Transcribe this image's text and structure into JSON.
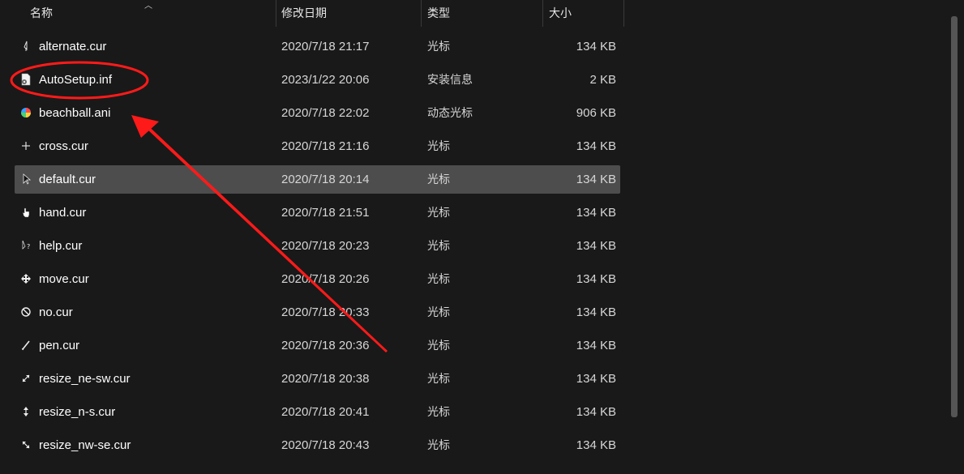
{
  "header": {
    "name": "名称",
    "date": "修改日期",
    "type": "类型",
    "size": "大小"
  },
  "files": [
    {
      "name": "alternate.cur",
      "date": "2020/7/18 21:17",
      "type": "光标",
      "size": "134 KB",
      "icon": "cursor-alternate-icon"
    },
    {
      "name": "AutoSetup.inf",
      "date": "2023/1/22 20:06",
      "type": "安装信息",
      "size": "2 KB",
      "icon": "setup-info-file-icon"
    },
    {
      "name": "beachball.ani",
      "date": "2020/7/18 22:02",
      "type": "动态光标",
      "size": "906 KB",
      "icon": "beachball-icon"
    },
    {
      "name": "cross.cur",
      "date": "2020/7/18 21:16",
      "type": "光标",
      "size": "134 KB",
      "icon": "cross-icon"
    },
    {
      "name": "default.cur",
      "date": "2020/7/18 20:14",
      "type": "光标",
      "size": "134 KB",
      "icon": "arrow-cursor-icon"
    },
    {
      "name": "hand.cur",
      "date": "2020/7/18 21:51",
      "type": "光标",
      "size": "134 KB",
      "icon": "hand-icon"
    },
    {
      "name": "help.cur",
      "date": "2020/7/18 20:23",
      "type": "光标",
      "size": "134 KB",
      "icon": "help-cursor-icon"
    },
    {
      "name": "move.cur",
      "date": "2020/7/18 20:26",
      "type": "光标",
      "size": "134 KB",
      "icon": "move-icon"
    },
    {
      "name": "no.cur",
      "date": "2020/7/18 20:33",
      "type": "光标",
      "size": "134 KB",
      "icon": "no-icon"
    },
    {
      "name": "pen.cur",
      "date": "2020/7/18 20:36",
      "type": "光标",
      "size": "134 KB",
      "icon": "pen-icon"
    },
    {
      "name": "resize_ne-sw.cur",
      "date": "2020/7/18 20:38",
      "type": "光标",
      "size": "134 KB",
      "icon": "resize-ne-sw-icon"
    },
    {
      "name": "resize_n-s.cur",
      "date": "2020/7/18 20:41",
      "type": "光标",
      "size": "134 KB",
      "icon": "resize-n-s-icon"
    },
    {
      "name": "resize_nw-se.cur",
      "date": "2020/7/18 20:43",
      "type": "光标",
      "size": "134 KB",
      "icon": "resize-nw-se-icon"
    }
  ],
  "selected_row": 4,
  "colors": {
    "background": "#191919",
    "selected": "#4d4d4d",
    "annotation": "#ff1a1a"
  }
}
